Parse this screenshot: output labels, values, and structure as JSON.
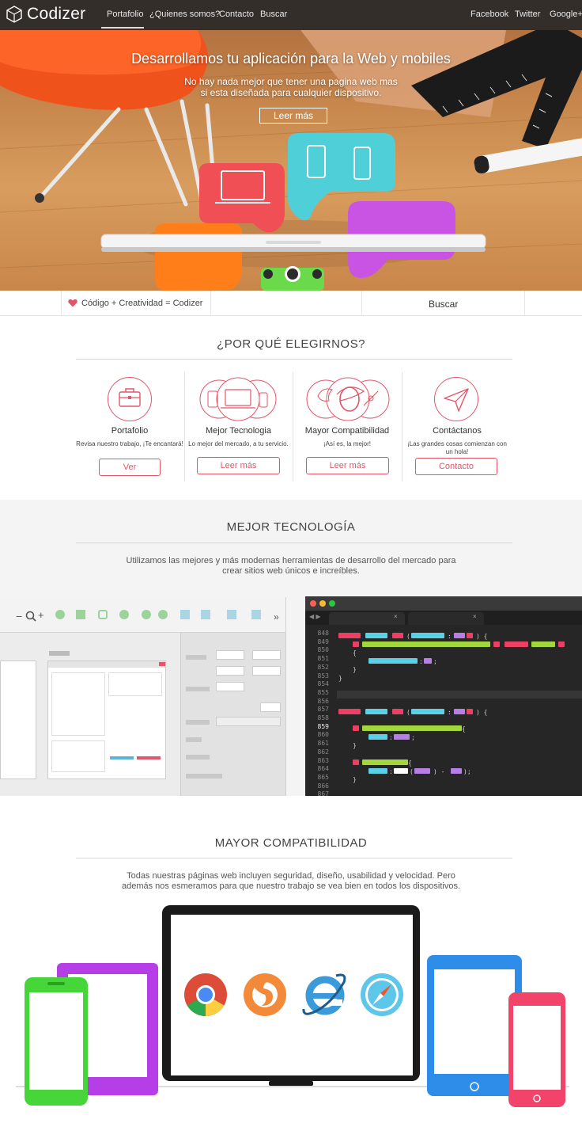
{
  "nav": {
    "logo": "Codizer",
    "links": [
      "Portafolio",
      "¿Quienes somos?",
      "Contacto",
      "Buscar"
    ],
    "social": [
      "Facebook",
      "Twitter",
      "Google+"
    ]
  },
  "hero": {
    "title": "Desarrollamos tu aplicación para la Web y mobiles",
    "subtitle": "No hay nada mejor que tener una pagina web mas si esta diseñada para cualquier dispositivo.",
    "button": "Leer más",
    "slides": 3,
    "active_slide": 2
  },
  "bar": {
    "tagline": "Código + Creatividad = Codizer",
    "search": "Buscar"
  },
  "why": {
    "title": "¿POR QUÉ ELEGIRNOS?",
    "features": [
      {
        "icon": "briefcase-icon",
        "title": "Portafolio",
        "text": "Revisa nuestro trabajo, ¡Te encantará!",
        "button": "Ver"
      },
      {
        "icon": "devices-icon",
        "title": "Mejor Tecnologia",
        "text": "Lo mejor del mercado, a tu servicio.",
        "button": "Leer más"
      },
      {
        "icon": "browsers-icon",
        "title": "Mayor Compatibilidad",
        "text": "¡Así es, la mejor!",
        "button": "Leer más"
      },
      {
        "icon": "paper-plane-icon",
        "title": "Contáctanos",
        "text": "¡Las grandes cosas comienzan con un hola!",
        "button": "Contacto"
      }
    ]
  },
  "tech": {
    "title": "MEJOR TECNOLOGÍA",
    "description": "Utilizamos las mejores y más modernas herramientas de desarrollo del mercado para crear sitios web únicos e increíbles.",
    "line_numbers": [
      "848",
      "849",
      "850",
      "851",
      "852",
      "853",
      "854",
      "855",
      "856",
      "857",
      "858",
      "859",
      "860",
      "861",
      "862",
      "863",
      "864",
      "865",
      "866",
      "867"
    ]
  },
  "compat": {
    "title": "MAYOR COMPATIBILIDAD",
    "description": "Todas nuestras páginas web incluyen seguridad, diseño, usabilidad y velocidad. Pero además nos esmeramos para que nuestro trabajo se vea bien en todos los dispositivos."
  },
  "colors": {
    "accent": "#e3566a",
    "nav_bg": "#231c18",
    "chrome": "#dd4b39",
    "firefox": "#f28a3a",
    "ie": "#3b9ad9",
    "safari": "#5ec6e8"
  }
}
